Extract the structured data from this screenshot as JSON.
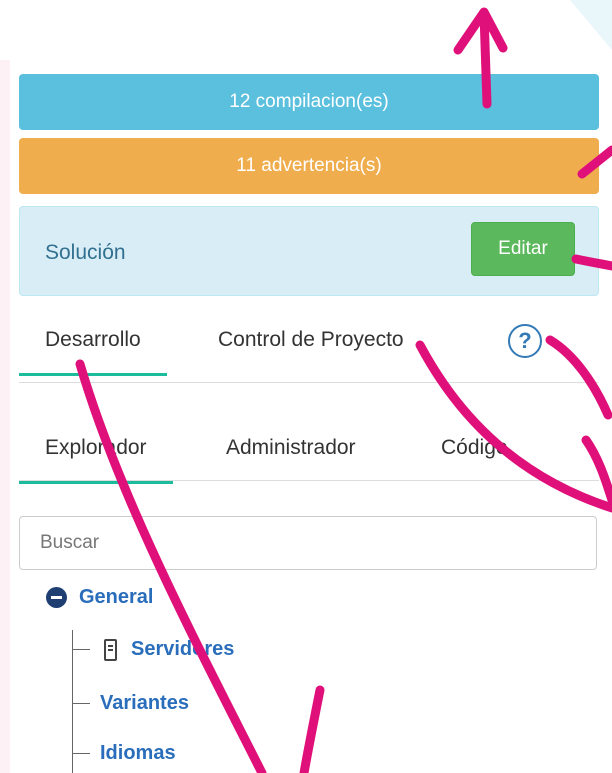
{
  "banners": {
    "builds": "12 compilacion(es)",
    "warnings": "11 advertencia(s)"
  },
  "solution": {
    "label": "Solución",
    "edit_label": "Editar"
  },
  "top_tabs": [
    {
      "label": "Desarrollo",
      "active": true
    },
    {
      "label": "Control de Proyecto",
      "active": false
    }
  ],
  "help_icon": {
    "glyph": "?"
  },
  "sub_tabs": [
    {
      "label": "Explorador",
      "active": true
    },
    {
      "label": "Administrador",
      "active": false
    },
    {
      "label": "Código",
      "active": false
    }
  ],
  "search": {
    "placeholder": "Buscar",
    "value": ""
  },
  "tree": {
    "root": "General",
    "children": [
      "Servidores",
      "Variantes",
      "Idiomas"
    ]
  },
  "icons": {
    "help": "help-circle-icon",
    "collapse": "minus-circle-icon",
    "server": "server-icon"
  },
  "colors": {
    "info": "#5bc0de",
    "warning": "#f0ad4e",
    "success": "#5cb85c",
    "active_tab": "#1abc9c",
    "link": "#2a6ebb",
    "annotation": "#e0107a"
  }
}
